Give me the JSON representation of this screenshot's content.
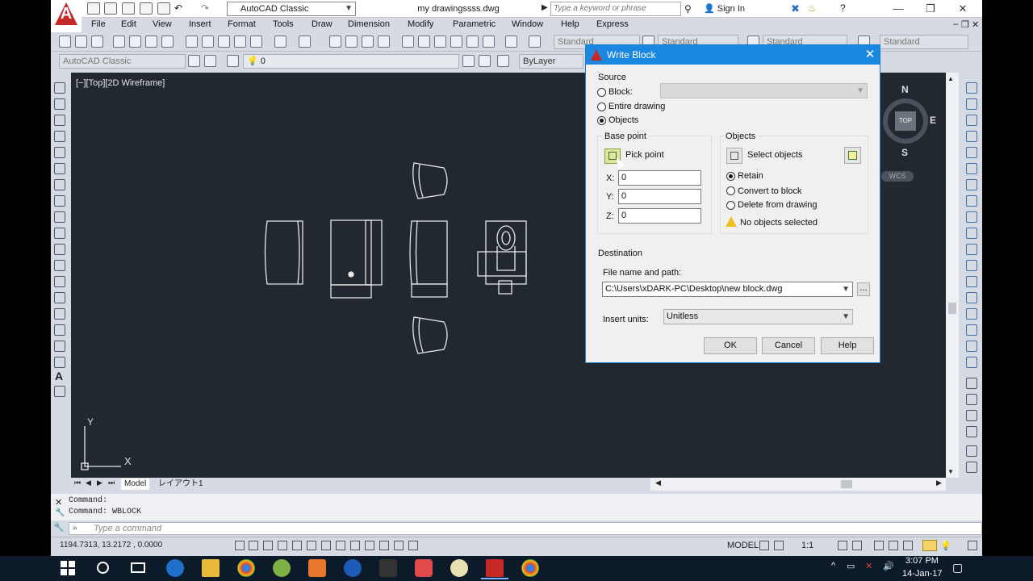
{
  "titlebar": {
    "workspace": "AutoCAD Classic",
    "document": "my drawingssss.dwg",
    "search_placeholder": "Type a keyword or phrase",
    "sign_in": "Sign In",
    "minimize": "—",
    "restore": "❐",
    "close": "✕"
  },
  "menu": [
    "File",
    "Edit",
    "View",
    "Insert",
    "Format",
    "Tools",
    "Draw",
    "Dimension",
    "Modify",
    "Parametric",
    "Window",
    "Help",
    "Express"
  ],
  "toolbar2": {
    "workspace": "AutoCAD Classic",
    "layer_value": "0",
    "linetype": "ByLayer",
    "text_style": "Standard",
    "dim_style": "Standard",
    "table_style": "Standard",
    "mleader_style": "Standard"
  },
  "viewport_label": "[−][Top][2D Wireframe]",
  "viewcube": {
    "n": "N",
    "s": "S",
    "e": "E",
    "top": "TOP",
    "wcs": "WCS"
  },
  "ucs": {
    "x": "X",
    "y": "Y"
  },
  "layout_tabs": [
    "Model",
    "レイアウト1"
  ],
  "command": {
    "history": [
      "Command:",
      "Command: WBLOCK"
    ],
    "placeholder": "Type a command",
    "prompt": "»"
  },
  "status": {
    "coords": "1194.7313, 13.2172 , 0.0000",
    "model": "MODEL",
    "scale": "1:1"
  },
  "dialog": {
    "title": "Write Block",
    "source_label": "Source",
    "source_options": [
      "Block:",
      "Entire drawing",
      "Objects"
    ],
    "source_selected": "Objects",
    "base_point_label": "Base point",
    "pick_point": "Pick point",
    "x_label": "X:",
    "y_label": "Y:",
    "z_label": "Z:",
    "x": "0",
    "y": "0",
    "z": "0",
    "objects_label": "Objects",
    "select_objects": "Select objects",
    "object_options": [
      "Retain",
      "Convert to block",
      "Delete from drawing"
    ],
    "object_selected": "Retain",
    "warning": "No objects selected",
    "destination_label": "Destination",
    "file_label": "File name and path:",
    "file_path": "C:\\Users\\xDARK-PC\\Desktop\\new block.dwg",
    "browse": "...",
    "units_label": "Insert units:",
    "units": "Unitless",
    "ok": "OK",
    "cancel": "Cancel",
    "help": "Help"
  },
  "clock": {
    "time": "3:07 PM",
    "date": "14-Jan-17"
  }
}
